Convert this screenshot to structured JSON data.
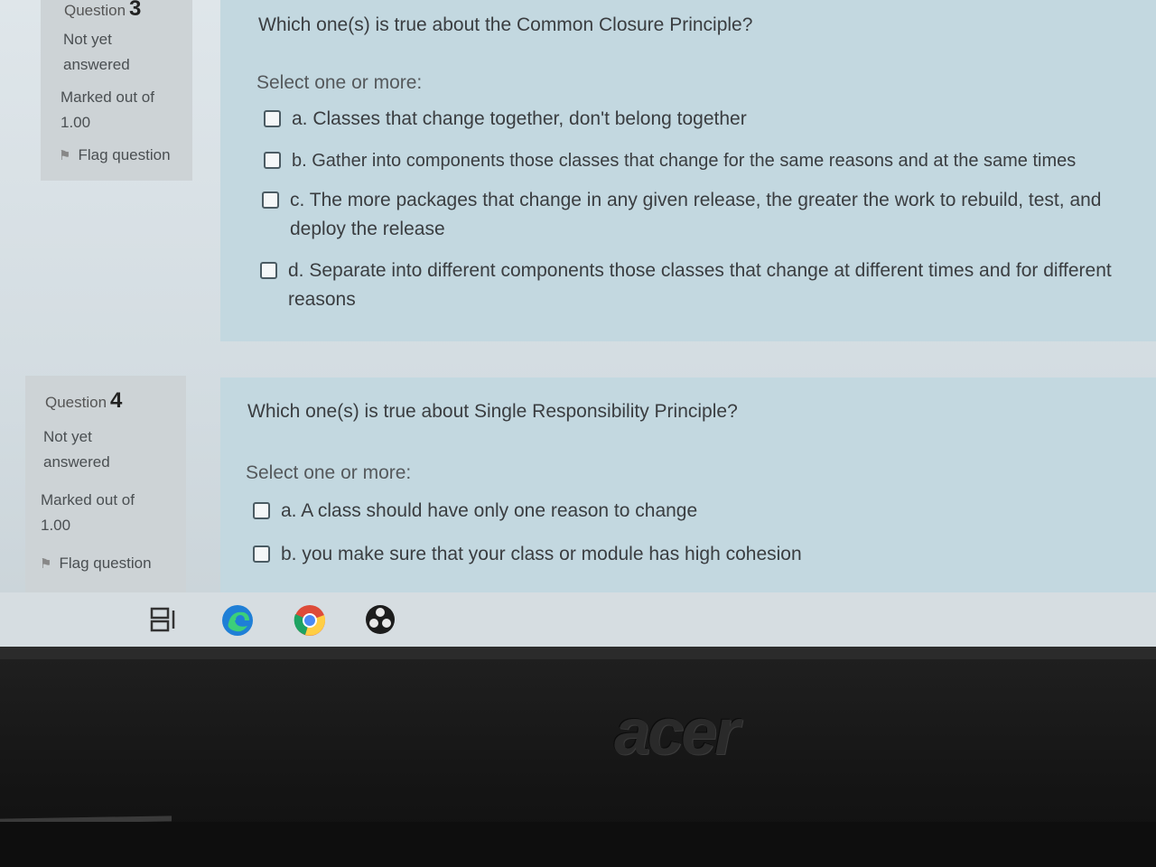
{
  "questions": [
    {
      "number_label": "Question",
      "number": "3",
      "status_line1": "Not yet",
      "status_line2": "answered",
      "marked_line1": "Marked out of",
      "marked_line2": "1.00",
      "flag_label": "Flag question",
      "text": "Which one(s) is true about the Common Closure Principle?",
      "prompt": "Select one or more:",
      "options": [
        {
          "label": "a. Classes that change together, don't belong together"
        },
        {
          "label": "b. Gather into components those classes that change for the same reasons and at the same times"
        },
        {
          "label": "c. The more packages that change in any given release, the greater the work to rebuild, test, and deploy the release"
        },
        {
          "label": "d. Separate into different components those classes that change at different times and for different reasons"
        }
      ]
    },
    {
      "number_label": "Question",
      "number": "4",
      "status_line1": "Not yet",
      "status_line2": "answered",
      "marked_line1": "Marked out of",
      "marked_line2": "1.00",
      "flag_label": "Flag question",
      "text": "Which one(s) is true about Single Responsibility Principle?",
      "prompt": "Select one or more:",
      "options": [
        {
          "label": "a. A class should have only one reason to change"
        },
        {
          "label": "b. you make sure that your class or module has high cohesion"
        }
      ]
    }
  ],
  "taskbar": {
    "icons": [
      "task-view-icon",
      "edge-browser-icon",
      "chrome-browser-icon",
      "obs-studio-icon"
    ]
  },
  "hardware": {
    "brand": "acer"
  },
  "colors": {
    "panel_bg": "#c3d8e0",
    "info_bg": "#cdd3d6"
  }
}
